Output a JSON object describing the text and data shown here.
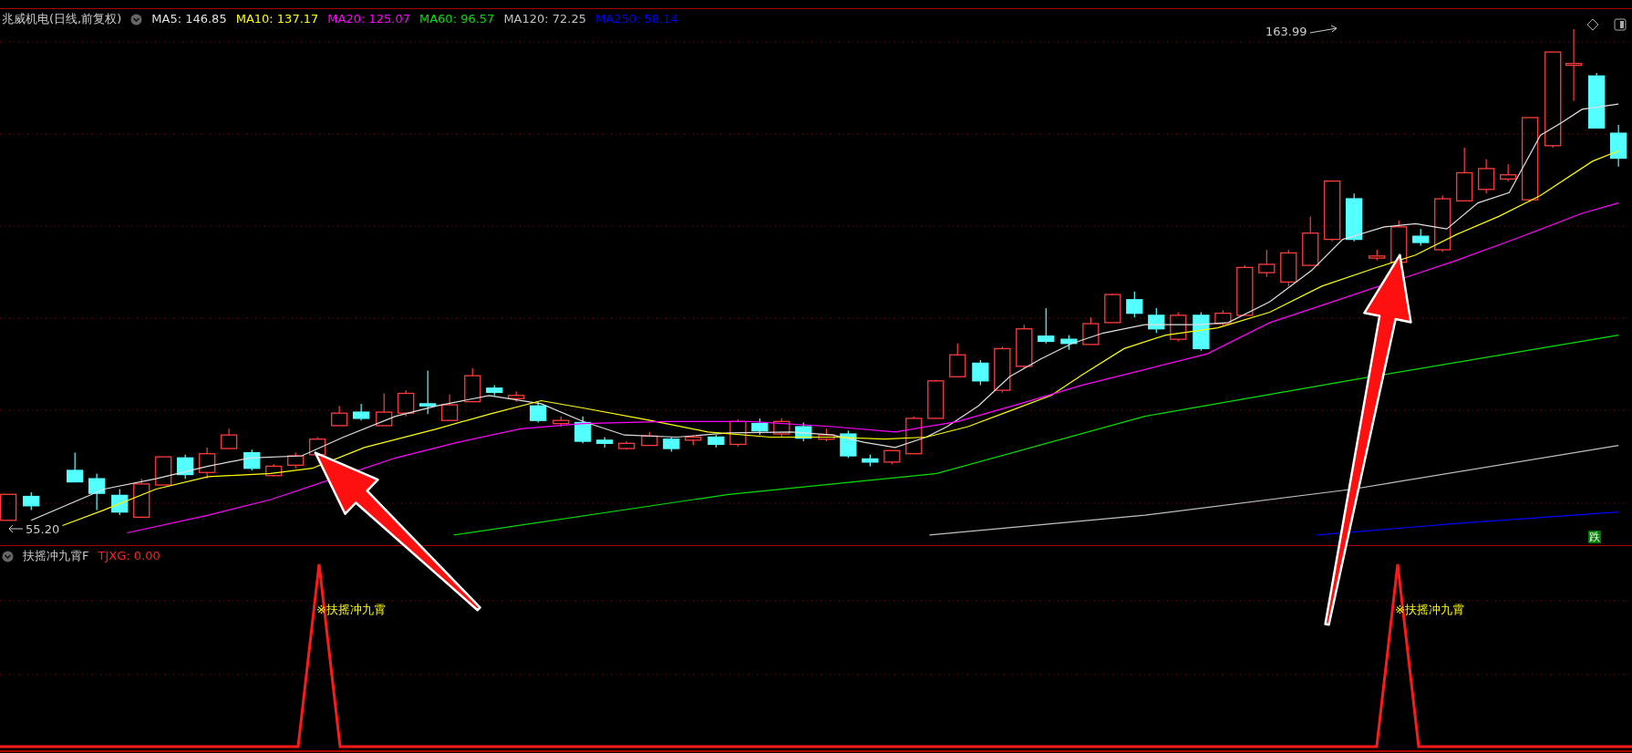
{
  "chart": {
    "title": "兆威机电(日线,前复权)",
    "ma_legend": [
      {
        "label": "MA5: 146.85",
        "color": "#e0e0e0"
      },
      {
        "label": "MA10: 137.17",
        "color": "#ffff00"
      },
      {
        "label": "MA20: 125.07",
        "color": "#ff00ff"
      },
      {
        "label": "MA60: 96.57",
        "color": "#00e000"
      },
      {
        "label": "MA120: 72.25",
        "color": "#c0c0c0"
      },
      {
        "label": "MA250: 58.14",
        "color": "#0000ff"
      }
    ],
    "max_label": "163.99",
    "min_label": "55.20",
    "badge": "跌"
  },
  "indicator": {
    "name": "扶摇冲九霄F",
    "value": "TJXG: 0.00",
    "signals": [
      {
        "label": "※扶摇冲九霄"
      },
      {
        "label": "※扶摇冲九霄"
      }
    ]
  }
}
